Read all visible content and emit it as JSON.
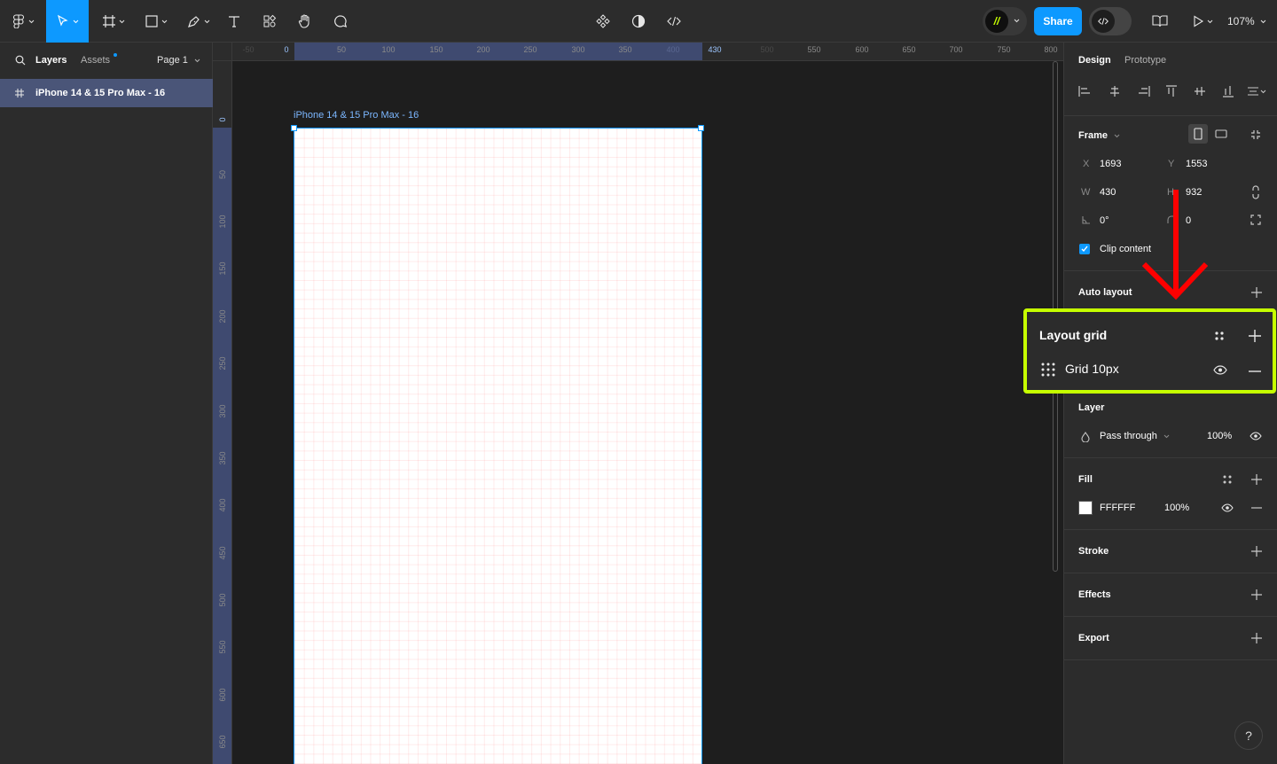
{
  "toolbar": {
    "share_label": "Share",
    "zoom": "107%",
    "avatar_initials": "//"
  },
  "left_panel": {
    "tabs": [
      "Layers",
      "Assets"
    ],
    "page_label": "Page 1",
    "layers": [
      {
        "name": "iPhone 14 & 15 Pro Max - 16",
        "selected": true
      }
    ]
  },
  "rulers": {
    "top": [
      "0",
      "50",
      "100",
      "150",
      "200",
      "250",
      "300",
      "350",
      "400",
      "430",
      "500",
      "550",
      "600",
      "650",
      "700",
      "750",
      "800"
    ],
    "top_faded": [
      "-50"
    ],
    "left": [
      "0",
      "50",
      "100",
      "150",
      "200",
      "250",
      "300",
      "350",
      "400",
      "450",
      "500",
      "550",
      "600",
      "650"
    ]
  },
  "canvas": {
    "frame_label": "iPhone 14 & 15 Pro Max - 16"
  },
  "right_panel": {
    "tabs": [
      "Design",
      "Prototype"
    ],
    "frame": {
      "title": "Frame",
      "x_label": "X",
      "x": "1693",
      "y_label": "Y",
      "y": "1553",
      "w_label": "W",
      "w": "430",
      "h_label": "H",
      "h": "932",
      "rotation": "0°",
      "radius": "0",
      "clip_content": "Clip content"
    },
    "auto_layout": "Auto layout",
    "layout_grid": {
      "title": "Layout grid",
      "item": "Grid 10px"
    },
    "layer": {
      "title": "Layer",
      "blend": "Pass through",
      "opacity": "100%"
    },
    "fill": {
      "title": "Fill",
      "hex": "FFFFFF",
      "opacity": "100%"
    },
    "stroke": "Stroke",
    "effects": "Effects",
    "export": "Export"
  },
  "help": "?",
  "colors": {
    "accent": "#0d99ff",
    "highlight": "#c6ff00",
    "arrow": "#ff0000"
  }
}
